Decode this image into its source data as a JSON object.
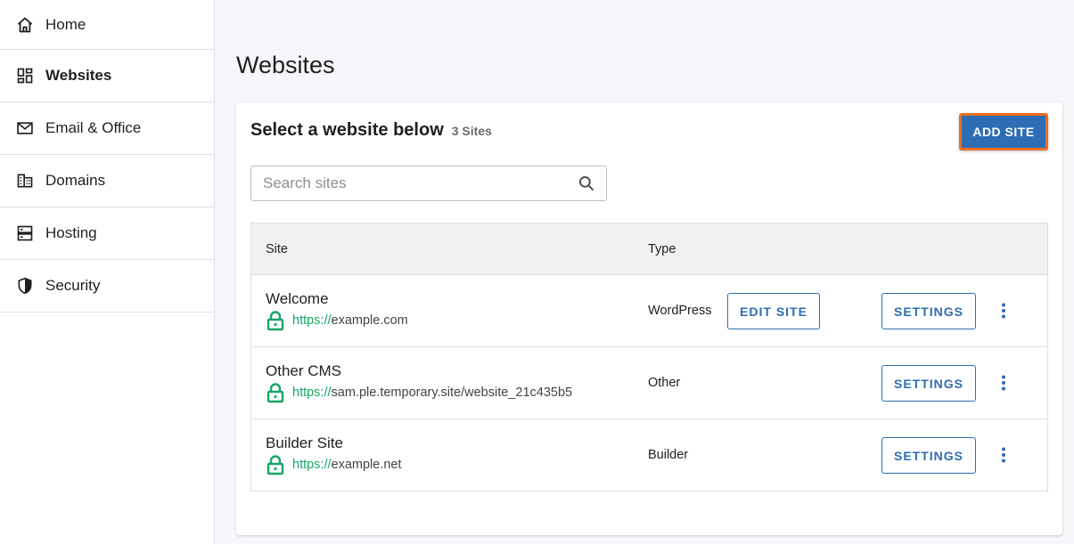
{
  "sidebar": {
    "items": [
      {
        "label": "Home",
        "icon": "home-icon"
      },
      {
        "label": "Websites",
        "icon": "websites-icon",
        "active": true
      },
      {
        "label": "Email & Office",
        "icon": "mail-icon"
      },
      {
        "label": "Domains",
        "icon": "building-icon"
      },
      {
        "label": "Hosting",
        "icon": "server-icon"
      },
      {
        "label": "Security",
        "icon": "shield-icon"
      }
    ]
  },
  "main": {
    "page_title": "Websites",
    "card_title": "Select a website below",
    "site_count": "3 Sites",
    "add_site_label": "ADD SITE",
    "search": {
      "placeholder": "Search sites",
      "value": ""
    },
    "table": {
      "columns": [
        "Site",
        "Type"
      ],
      "rows": [
        {
          "name": "Welcome",
          "url_proto": "https://",
          "url_host": "example.com",
          "type": "WordPress",
          "edit_label": "EDIT SITE",
          "settings_label": "SETTINGS"
        },
        {
          "name": "Other CMS",
          "url_proto": "https://",
          "url_host": "sam.ple.temporary.site/website_21c435b5",
          "type": "Other",
          "settings_label": "SETTINGS"
        },
        {
          "name": "Builder Site",
          "url_proto": "https://",
          "url_host": "example.net",
          "type": "Builder",
          "settings_label": "SETTINGS"
        }
      ]
    }
  },
  "colors": {
    "accent": "#2e6db4",
    "highlight": "#ee6d1f",
    "secure_green": "#18a566"
  }
}
